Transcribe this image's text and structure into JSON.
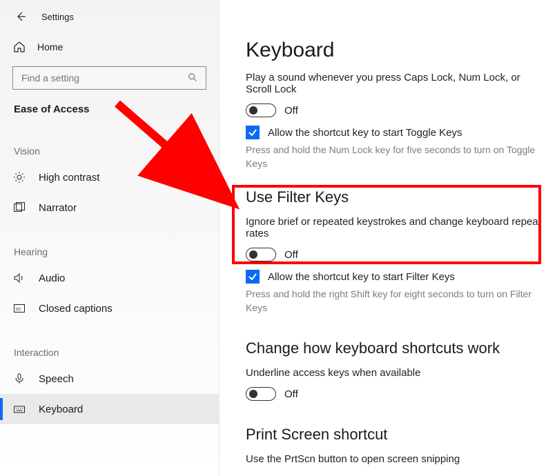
{
  "header": {
    "title": "Settings"
  },
  "sidebar": {
    "home": "Home",
    "search_placeholder": "Find a setting",
    "section": "Ease of Access",
    "categories": {
      "vision": "Vision",
      "hearing": "Hearing",
      "interaction": "Interaction"
    },
    "items": {
      "high_contrast": "High contrast",
      "narrator": "Narrator",
      "audio": "Audio",
      "closed_captions": "Closed captions",
      "speech": "Speech",
      "keyboard": "Keyboard"
    }
  },
  "main": {
    "page_title": "Keyboard",
    "caps_desc": "Play a sound whenever you press Caps Lock, Num Lock, or Scroll Lock",
    "off": "Off",
    "toggle_keys_chk": "Allow the shortcut key to start Toggle Keys",
    "toggle_keys_hint": "Press and hold the Num Lock key for five seconds to turn on Toggle Keys",
    "filter_title": "Use Filter Keys",
    "filter_desc": "Ignore brief or repeated keystrokes and change keyboard repeat rates",
    "filter_chk": "Allow the shortcut key to start Filter Keys",
    "filter_hint": "Press and hold the right Shift key for eight seconds to turn on Filter Keys",
    "shortcuts_title": "Change how keyboard shortcuts work",
    "underline_desc": "Underline access keys when available",
    "prtscn_title": "Print Screen shortcut",
    "prtscn_desc": "Use the PrtScn button to open screen snipping"
  }
}
